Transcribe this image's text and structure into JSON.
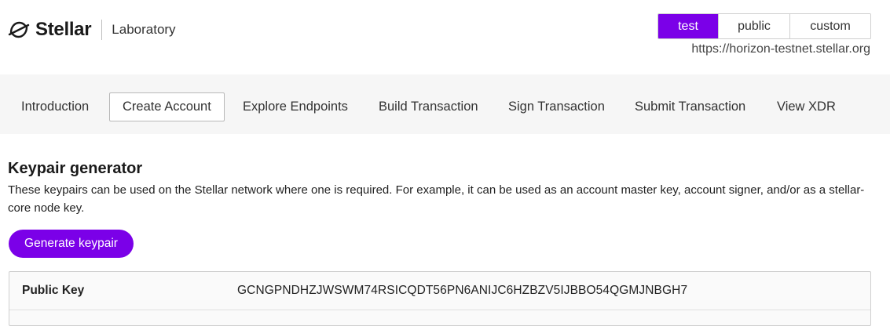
{
  "brand": {
    "name": "Stellar",
    "subtitle": "Laboratory",
    "icon": "stellar-logo-icon"
  },
  "network": {
    "options": [
      {
        "label": "test",
        "active": true
      },
      {
        "label": "public",
        "active": false
      },
      {
        "label": "custom",
        "active": false
      }
    ],
    "horizon_url": "https://horizon-testnet.stellar.org"
  },
  "nav": {
    "items": [
      {
        "label": "Introduction",
        "active": false
      },
      {
        "label": "Create Account",
        "active": true
      },
      {
        "label": "Explore Endpoints",
        "active": false
      },
      {
        "label": "Build Transaction",
        "active": false
      },
      {
        "label": "Sign Transaction",
        "active": false
      },
      {
        "label": "Submit Transaction",
        "active": false
      },
      {
        "label": "View XDR",
        "active": false
      }
    ]
  },
  "keypair": {
    "title": "Keypair generator",
    "description": "These keypairs can be used on the Stellar network where one is required. For example, it can be used as an account master key, account signer, and/or as a stellar-core node key.",
    "generate_label": "Generate keypair",
    "public_key_label": "Public Key",
    "public_key_value": "GCNGPNDHZJWSWM74RSICQDT56PN6ANIJC6HZBZV5IJBBO54QGMJNBGH7"
  },
  "colors": {
    "accent": "#7b00e8",
    "nav_background": "#f6f6f6"
  }
}
